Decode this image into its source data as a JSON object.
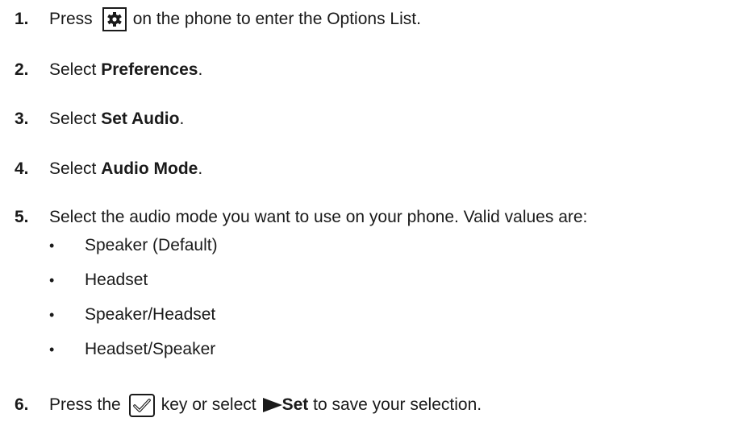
{
  "steps": [
    {
      "number": "1.",
      "before": "Press",
      "icon": "gear-icon",
      "after": "on the phone to enter the Options List."
    },
    {
      "number": "2.",
      "before": "Select",
      "bold": "Preferences",
      "after": "."
    },
    {
      "number": "3.",
      "before": "Select",
      "bold": "Set Audio",
      "after": "."
    },
    {
      "number": "4.",
      "before": "Select",
      "bold": "Audio Mode",
      "after": "."
    },
    {
      "number": "5.",
      "text": "Select the audio mode you want to use on your phone. Valid values are:",
      "bullets": [
        "Speaker (Default)",
        "Headset",
        "Speaker/Headset",
        "Headset/Speaker"
      ]
    },
    {
      "number": "6.",
      "before": "Press the",
      "icon": "checkmark-key-icon",
      "middle": "key or select",
      "arrow_icon": "right-triangle-icon",
      "bold": "Set",
      "after": "to save your selection."
    }
  ],
  "bullet_glyph": "•"
}
